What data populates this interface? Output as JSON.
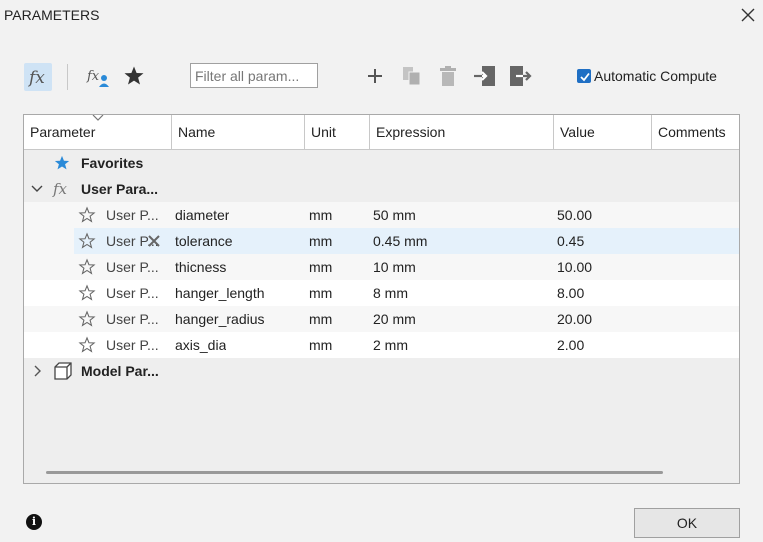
{
  "window": {
    "title": "PARAMETERS",
    "close_label": "×"
  },
  "toolbar": {
    "fx_label": "fx",
    "user_fx_label": "fx",
    "filter_placeholder": "Filter all param...",
    "automatic_compute_label": "Automatic Compute",
    "automatic_compute_checked": true
  },
  "columns": [
    "Parameter",
    "Name",
    "Unit",
    "Expression",
    "Value",
    "Comments"
  ],
  "groups": {
    "favorites": {
      "label": "Favorites"
    },
    "user": {
      "label": "User Para...",
      "expanded": true
    },
    "model": {
      "label": "Model Par...",
      "expanded": false
    }
  },
  "rows": [
    {
      "parameter": "User P...",
      "name": "diameter",
      "unit": "mm",
      "expression": "50 mm",
      "value": "50.00",
      "comments": ""
    },
    {
      "parameter": "User P...",
      "name": "tolerance",
      "unit": "mm",
      "expression": "0.45 mm",
      "value": "0.45",
      "comments": ""
    },
    {
      "parameter": "User P...",
      "name": "thicness",
      "unit": "mm",
      "expression": "10 mm",
      "value": "10.00",
      "comments": ""
    },
    {
      "parameter": "User P...",
      "name": "hanger_length",
      "unit": "mm",
      "expression": "8 mm",
      "value": "8.00",
      "comments": ""
    },
    {
      "parameter": "User P...",
      "name": "hanger_radius",
      "unit": "mm",
      "expression": "20 mm",
      "value": "20.00",
      "comments": ""
    },
    {
      "parameter": "User P...",
      "name": "axis_dia",
      "unit": "mm",
      "expression": "2 mm",
      "value": "2.00",
      "comments": ""
    }
  ],
  "footer": {
    "ok_label": "OK",
    "info_label": "i"
  },
  "colors": {
    "accent": "#1f6fc4",
    "selected_row": "#e5f1fb",
    "fx_button_bg": "#cfe3f5"
  }
}
